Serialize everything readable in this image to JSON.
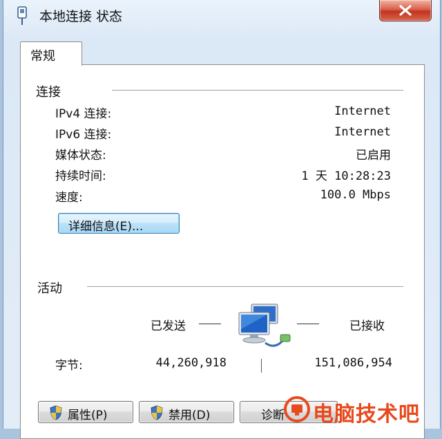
{
  "window": {
    "title": "本地连接 状态"
  },
  "tabs": [
    {
      "label": "常规"
    }
  ],
  "connection": {
    "section_title": "连接",
    "rows": [
      {
        "label": "IPv4 连接:",
        "value": "Internet"
      },
      {
        "label": "IPv6 连接:",
        "value": "Internet"
      },
      {
        "label": "媒体状态:",
        "value": "已启用"
      },
      {
        "label": "持续时间:",
        "value": "1 天 10:28:23"
      },
      {
        "label": "速度:",
        "value": "100.0 Mbps"
      }
    ],
    "details_button": "详细信息(E)..."
  },
  "activity": {
    "section_title": "活动",
    "sent_label": "已发送",
    "received_label": "已接收",
    "bytes_label": "字节:",
    "bytes_sent": "44,260,918",
    "bytes_received": "151,086,954"
  },
  "buttons": {
    "properties": "属性(P)",
    "disable": "禁用(D)",
    "diagnose": "诊断"
  },
  "watermark": {
    "text": "电脑技术吧"
  },
  "colors": {
    "close_button": "#c9402a",
    "focus_button": "#bde2f8",
    "watermark": "#e8491d"
  }
}
